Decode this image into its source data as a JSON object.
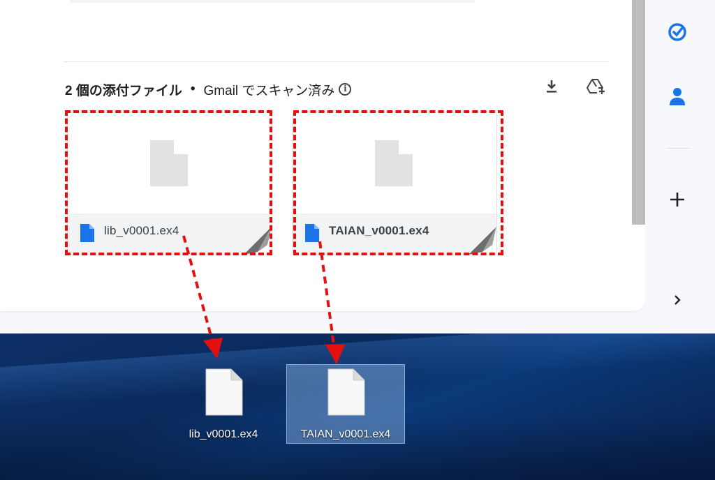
{
  "attachments_header": {
    "count_label": "2 個の添付ファイル",
    "separator": "•",
    "scan_label": "Gmail でスキャン済み"
  },
  "header_actions": [
    {
      "icon": "download-icon"
    },
    {
      "icon": "add-to-drive-icon"
    }
  ],
  "attachments": [
    {
      "file_name": "lib_v0001.ex4"
    },
    {
      "file_name": "TAIAN_v0001.ex4"
    }
  ],
  "right_rail": [
    {
      "icon": "tasks-icon"
    },
    {
      "icon": "contacts-icon"
    },
    {
      "icon": "add-icon"
    },
    {
      "icon": "chevron-right-icon"
    }
  ],
  "desktop_icons": [
    {
      "label": "lib_v0001.ex4",
      "selected": false
    },
    {
      "label": "TAIAN_v0001.ex4",
      "selected": true
    }
  ],
  "colors": {
    "highlight": "#e41010",
    "accent_blue": "#1a73e8",
    "desktop_blue": "#0a2a5c"
  }
}
